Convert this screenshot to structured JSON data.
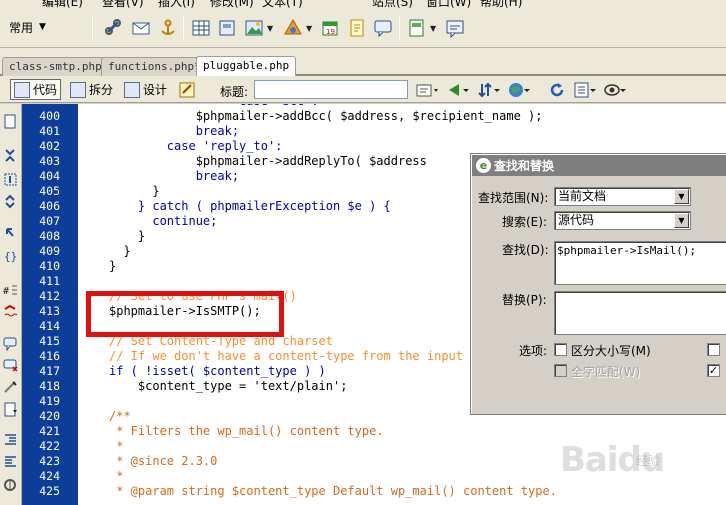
{
  "menubar": {
    "items": [
      "编辑(E)",
      "查看(V)",
      "插入(I)",
      "修改(M)",
      "文本(T)",
      "站点(S)",
      "窗口(W)",
      "帮助(H)"
    ]
  },
  "toolbar": {
    "workspace_label": "常用"
  },
  "tabs": [
    {
      "label": "class-smtp.php",
      "active": false
    },
    {
      "label": "functions.php*",
      "active": false
    },
    {
      "label": "pluggable.php",
      "active": true
    }
  ],
  "viewbar": {
    "code_label": "代码",
    "split_label": "拆分",
    "design_label": "设计",
    "title_label": "标题:",
    "title_value": ""
  },
  "editor": {
    "gutter_color": "#0c3e99",
    "highlight_color": "#e01010",
    "lines": [
      {
        "num": "400",
        "text": "            $phpmailer->addBcc( $address, $recipient_name );"
      },
      {
        "num": "401",
        "text": "            break;"
      },
      {
        "num": "402",
        "text": "        case 'reply_to':"
      },
      {
        "num": "403",
        "text": "            $phpmailer->addReplyTo( $address"
      },
      {
        "num": "404",
        "text": "            break;"
      },
      {
        "num": "405",
        "text": "      }"
      },
      {
        "num": "406",
        "text": "    } catch ( phpmailerException $e ) {"
      },
      {
        "num": "407",
        "text": "      continue;"
      },
      {
        "num": "408",
        "text": "    }"
      },
      {
        "num": "409",
        "text": "  }"
      },
      {
        "num": "410",
        "text": "}"
      },
      {
        "num": "411",
        "text": ""
      },
      {
        "num": "412",
        "text": "// Set to use PHP's mail()"
      },
      {
        "num": "413",
        "text": "$phpmailer->IsSMTP();"
      },
      {
        "num": "414",
        "text": ""
      },
      {
        "num": "415",
        "text": "// Set Content-Type and charset"
      },
      {
        "num": "416",
        "text": "// If we don't have a content-type from the input he"
      },
      {
        "num": "417",
        "text": "if ( !isset( $content_type ) )"
      },
      {
        "num": "418",
        "text": "    $content_type = 'text/plain';"
      },
      {
        "num": "419",
        "text": ""
      },
      {
        "num": "420",
        "text": "/**"
      },
      {
        "num": "421",
        "text": " * Filters the wp_mail() content type."
      },
      {
        "num": "422",
        "text": " *"
      },
      {
        "num": "423",
        "text": " * @since 2.3.0"
      },
      {
        "num": "424",
        "text": " *"
      },
      {
        "num": "425",
        "text": " * @param string $content_type Default wp_mail() content type."
      }
    ]
  },
  "dialog": {
    "title": "查找和替换",
    "scope_label": "查找范围(N):",
    "scope_value": "当前文档",
    "search_label": "搜索(E):",
    "search_value": "源代码",
    "find_label": "查找(D):",
    "find_value": "$phpmailer->IsMail();",
    "replace_label": "替换(P):",
    "replace_value": "",
    "options_label": "选项:",
    "match_case_label": "区分大小写(M)",
    "match_case_checked": false,
    "whole_word_label": "全字匹配(W)",
    "whole_word_checked": false,
    "right_checkbox_checked": true
  },
  "watermark": {
    "text": "Baidu",
    "sub": "经验"
  }
}
